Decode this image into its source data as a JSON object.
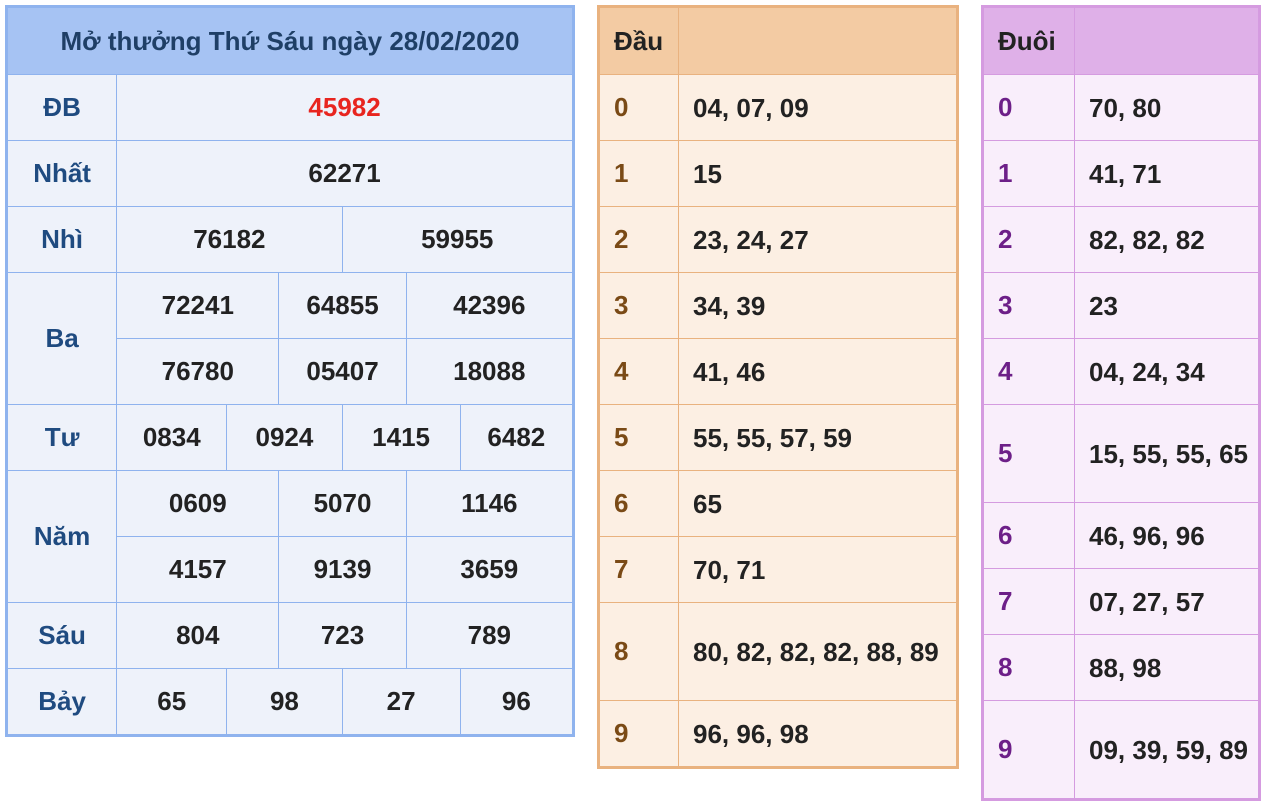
{
  "results": {
    "title": "Mở thưởng Thứ Sáu ngày 28/02/2020",
    "db": {
      "label": "ĐB",
      "values": [
        "45982"
      ]
    },
    "nhat": {
      "label": "Nhất",
      "values": [
        "62271"
      ]
    },
    "nhi": {
      "label": "Nhì",
      "values": [
        "76182",
        "59955"
      ]
    },
    "ba": {
      "label": "Ba",
      "values": [
        "72241",
        "64855",
        "42396",
        "76780",
        "05407",
        "18088"
      ]
    },
    "tu": {
      "label": "Tư",
      "values": [
        "0834",
        "0924",
        "1415",
        "6482"
      ]
    },
    "nam": {
      "label": "Năm",
      "values": [
        "0609",
        "5070",
        "1146",
        "4157",
        "9139",
        "3659"
      ]
    },
    "sau": {
      "label": "Sáu",
      "values": [
        "804",
        "723",
        "789"
      ]
    },
    "bay": {
      "label": "Bảy",
      "values": [
        "65",
        "98",
        "27",
        "96"
      ]
    }
  },
  "dau": {
    "header": "Đầu",
    "rows": [
      {
        "digit": "0",
        "values": "04, 07, 09"
      },
      {
        "digit": "1",
        "values": "15"
      },
      {
        "digit": "2",
        "values": "23, 24, 27"
      },
      {
        "digit": "3",
        "values": "34, 39"
      },
      {
        "digit": "4",
        "values": "41, 46"
      },
      {
        "digit": "5",
        "values": "55, 55, 57, 59"
      },
      {
        "digit": "6",
        "values": "65"
      },
      {
        "digit": "7",
        "values": "70, 71"
      },
      {
        "digit": "8",
        "values": "80, 82, 82, 82, 88, 89"
      },
      {
        "digit": "9",
        "values": "96, 96, 98"
      }
    ]
  },
  "duoi": {
    "header": "Đuôi",
    "rows": [
      {
        "digit": "0",
        "values": "70, 80"
      },
      {
        "digit": "1",
        "values": "41, 71"
      },
      {
        "digit": "2",
        "values": "82, 82, 82"
      },
      {
        "digit": "3",
        "values": "23"
      },
      {
        "digit": "4",
        "values": "04, 24, 34"
      },
      {
        "digit": "5",
        "values": "15, 55, 55, 65"
      },
      {
        "digit": "6",
        "values": "46, 96, 96"
      },
      {
        "digit": "7",
        "values": "07, 27, 57"
      },
      {
        "digit": "8",
        "values": "88, 98"
      },
      {
        "digit": "9",
        "values": "09, 39, 59, 89"
      }
    ]
  }
}
